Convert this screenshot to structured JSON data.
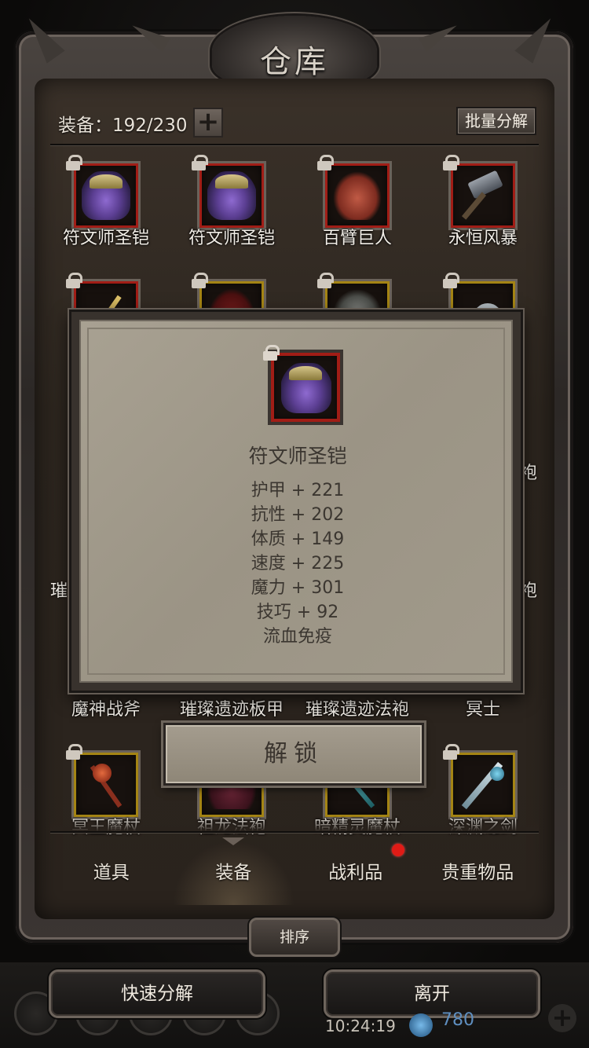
{
  "title": "仓库",
  "capacity": {
    "label": "装备：",
    "value": "192/230"
  },
  "bulk_button": "批量分解",
  "grid": [
    {
      "name": "符文师圣铠",
      "icon": "purple-armor-icon",
      "frame": "red"
    },
    {
      "name": "符文师圣铠",
      "icon": "purple-armor-icon",
      "frame": "red"
    },
    {
      "name": "百臂巨人",
      "icon": "red-armor-icon",
      "frame": "red"
    },
    {
      "name": "永恒风暴",
      "icon": "war-hammer-icon",
      "frame": "red"
    },
    {
      "name": "",
      "icon": "scepter-icon",
      "frame": "red"
    },
    {
      "name": "",
      "icon": "cloak-icon",
      "frame": "gold"
    },
    {
      "name": "",
      "icon": "bracer-icon",
      "frame": "gold"
    },
    {
      "name": "",
      "icon": "ring-icon",
      "frame": "gold"
    },
    {
      "name": "魔神战斧",
      "icon": "",
      "frame": "gold"
    },
    {
      "name": "璀璨遗迹板甲",
      "icon": "",
      "frame": "gold"
    },
    {
      "name": "璀璨遗迹法袍",
      "icon": "",
      "frame": "gold"
    },
    {
      "name": "冥士",
      "icon": "",
      "frame": "gold"
    },
    {
      "name": "冥王魔杖",
      "icon": "fire-staff-icon",
      "frame": "gold"
    },
    {
      "name": "祖龙法袍",
      "icon": "robe-icon",
      "frame": "gold"
    },
    {
      "name": "暗精灵魔杖",
      "icon": "wand-icon",
      "frame": "gold"
    },
    {
      "name": "深渊之剑",
      "icon": "sword-icon",
      "frame": "gold"
    }
  ],
  "peek_text": {
    "left_row3": "璀",
    "right_row2": "袍",
    "right_row3": "袍",
    "left_row2": ""
  },
  "popup": {
    "item_name": "符文师圣铠",
    "stats": [
      "护甲 + 221",
      "抗性 + 202",
      "体质 + 149",
      "速度 + 225",
      "魔力 + 301",
      "技巧 + 92",
      "流血免疫"
    ]
  },
  "unlock_button": "解锁",
  "tabs": [
    {
      "label": "道具",
      "active": false,
      "badge": false
    },
    {
      "label": "装备",
      "active": true,
      "badge": false
    },
    {
      "label": "战利品",
      "active": false,
      "badge": true
    },
    {
      "label": "贵重物品",
      "active": false,
      "badge": false
    }
  ],
  "sort_button": "排序",
  "quick_decompose_button": "快速分解",
  "leave_button": "离开",
  "status": {
    "clock": "10:24:19",
    "gems": "780"
  },
  "colors": {
    "rare_frame": "#a11d16",
    "epic_frame": "#a48414",
    "badge": "#e01b16",
    "parchment": "#a19a8b"
  }
}
